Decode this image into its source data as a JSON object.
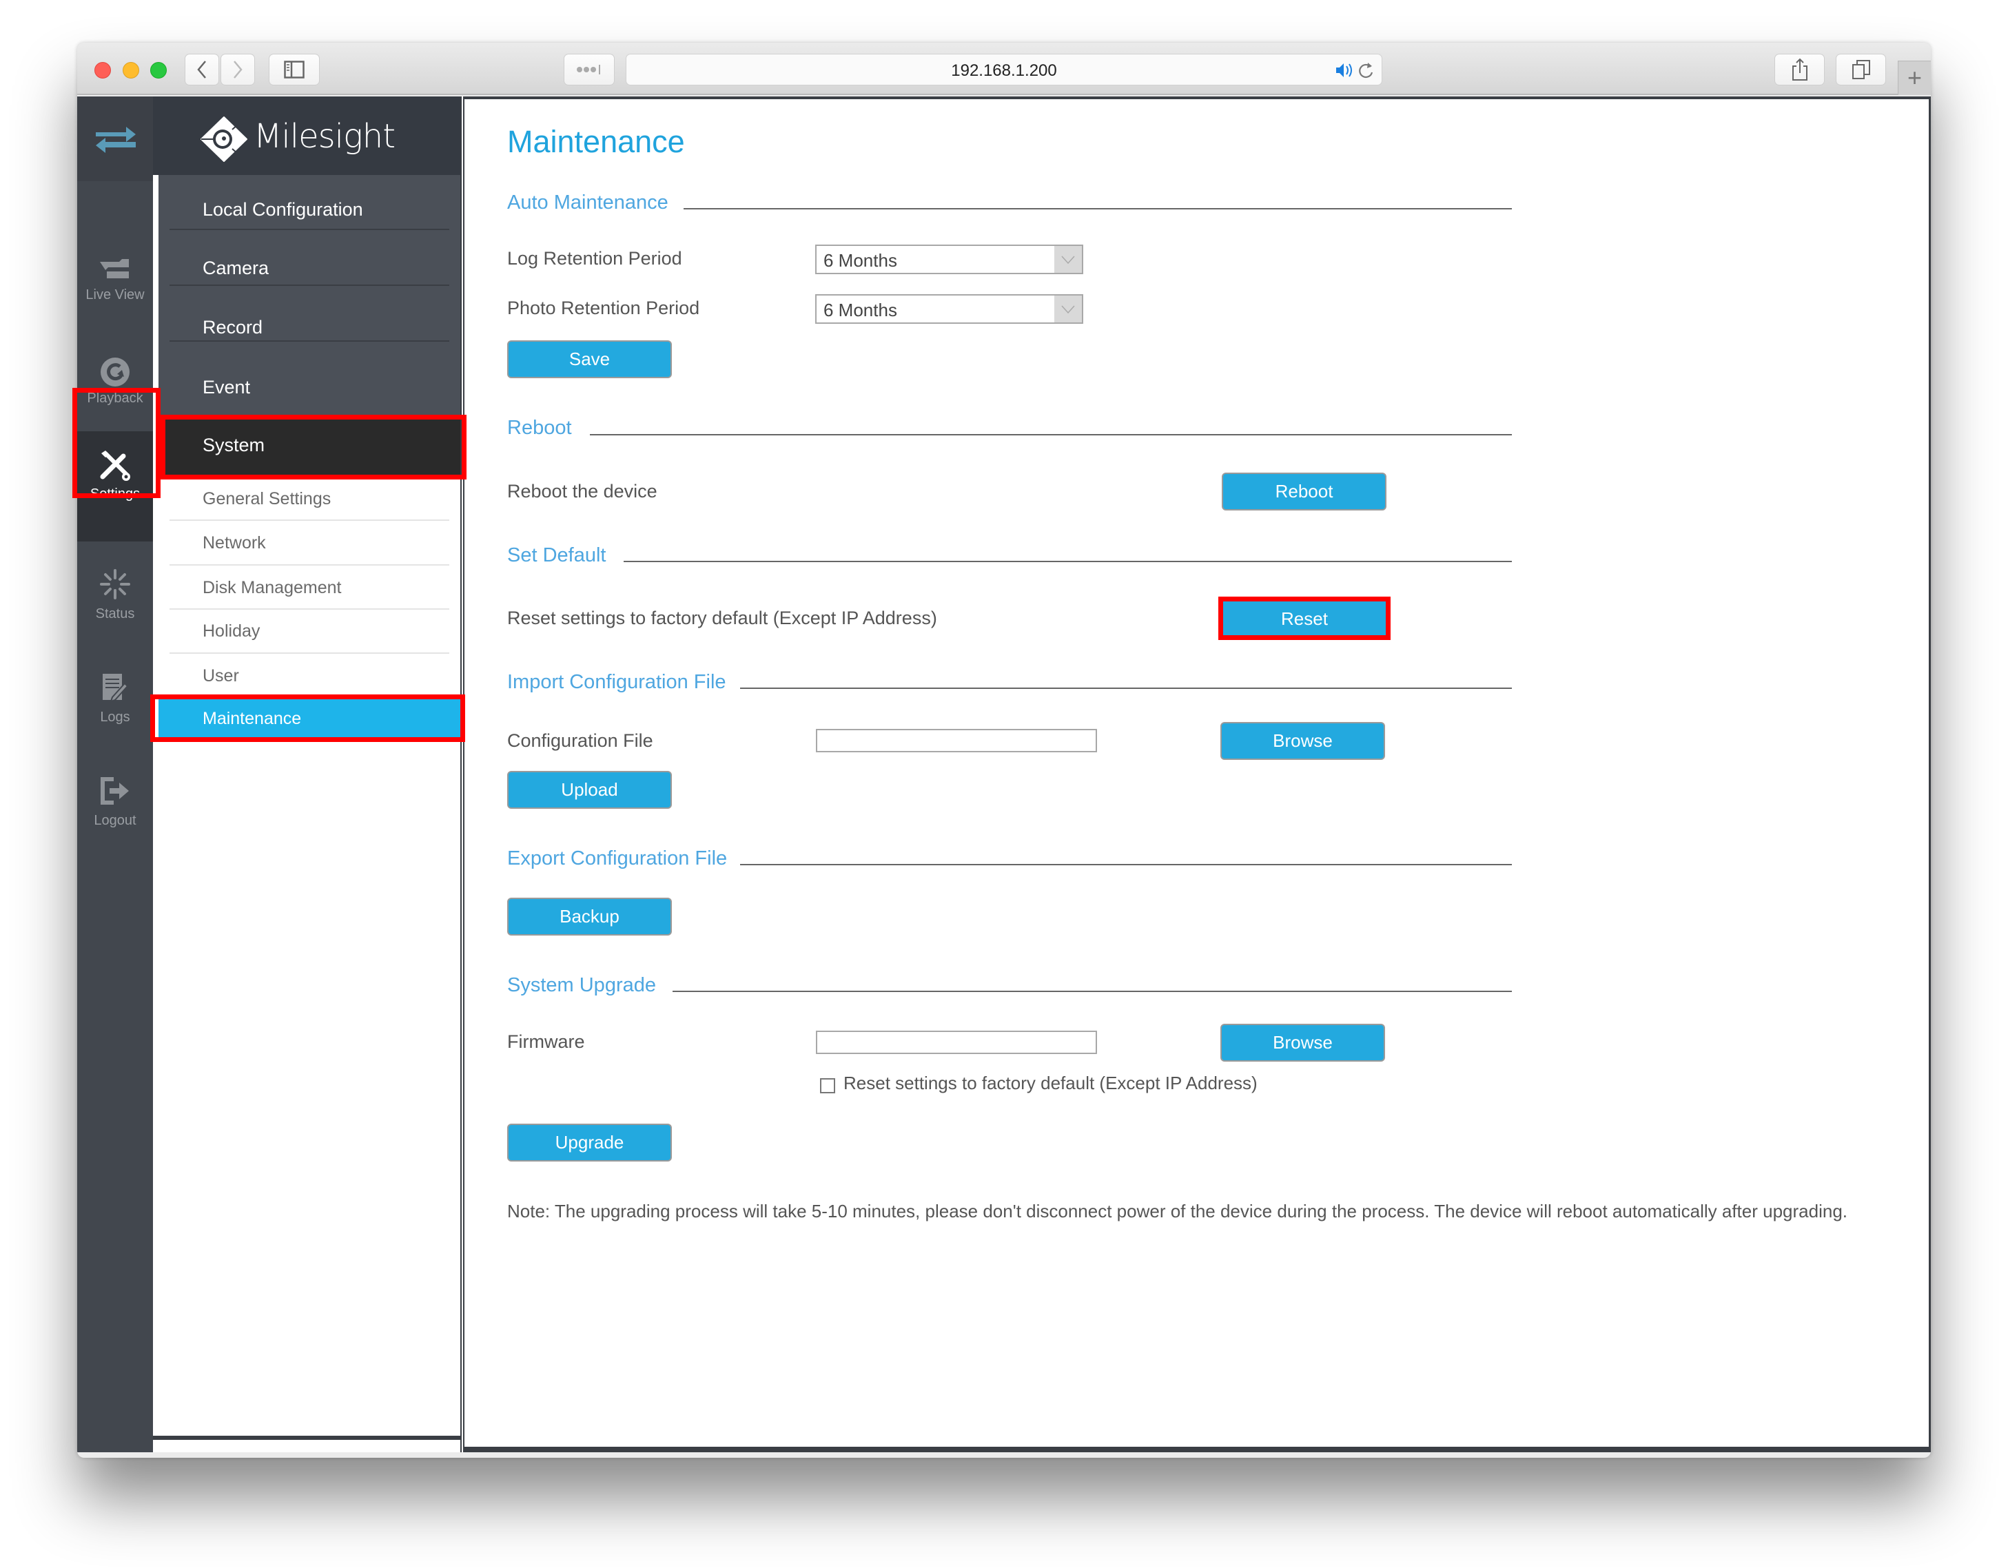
{
  "browser": {
    "url": "192.168.1.200",
    "traffic_lights": [
      "close",
      "minimize",
      "zoom"
    ],
    "colors": {
      "close": "#fe5f57",
      "minimize": "#febc2e",
      "zoom": "#28c840"
    }
  },
  "brand": {
    "name": "Milesight"
  },
  "rail": {
    "items": [
      {
        "id": "live-view",
        "label": "Live View",
        "icon": "live-view-icon"
      },
      {
        "id": "playback",
        "label": "Playback",
        "icon": "playback-icon"
      },
      {
        "id": "settings",
        "label": "Settings",
        "icon": "settings-icon",
        "active": true
      },
      {
        "id": "status",
        "label": "Status",
        "icon": "status-icon"
      },
      {
        "id": "logs",
        "label": "Logs",
        "icon": "logs-icon"
      },
      {
        "id": "logout",
        "label": "Logout",
        "icon": "logout-icon"
      }
    ]
  },
  "nav": {
    "main": [
      "Local Configuration",
      "Camera",
      "Record",
      "Event",
      "System"
    ],
    "active_main": "System",
    "sub": [
      "General Settings",
      "Network",
      "Disk Management",
      "Holiday",
      "User",
      "Maintenance"
    ],
    "active_sub": "Maintenance"
  },
  "page": {
    "title": "Maintenance",
    "sections": {
      "auto": {
        "title": "Auto Maintenance",
        "log_label": "Log Retention Period",
        "log_value": "6 Months",
        "photo_label": "Photo Retention Period",
        "photo_value": "6 Months",
        "save": "Save"
      },
      "reboot": {
        "title": "Reboot",
        "label": "Reboot the device",
        "button": "Reboot"
      },
      "default": {
        "title": "Set Default",
        "label": "Reset settings to factory default (Except IP Address)",
        "button": "Reset"
      },
      "import": {
        "title": "Import Configuration File",
        "label": "Configuration File",
        "file_value": "",
        "browse": "Browse",
        "upload": "Upload"
      },
      "export": {
        "title": "Export Configuration File",
        "backup": "Backup"
      },
      "upgrade": {
        "title": "System Upgrade",
        "label": "Firmware",
        "file_value": "",
        "browse": "Browse",
        "checkbox_label": "Reset settings to factory default (Except IP Address)",
        "checkbox_checked": false,
        "upgrade": "Upgrade",
        "note": "Note: The upgrading process will take 5-10 minutes, please don't disconnect power of the device during the process. The device will reboot automatically after upgrading."
      }
    }
  },
  "colors": {
    "accent": "#23a9df",
    "active_nav": "#1eb4ea",
    "highlight": "#ff0000",
    "sidebar": "#42474e"
  }
}
